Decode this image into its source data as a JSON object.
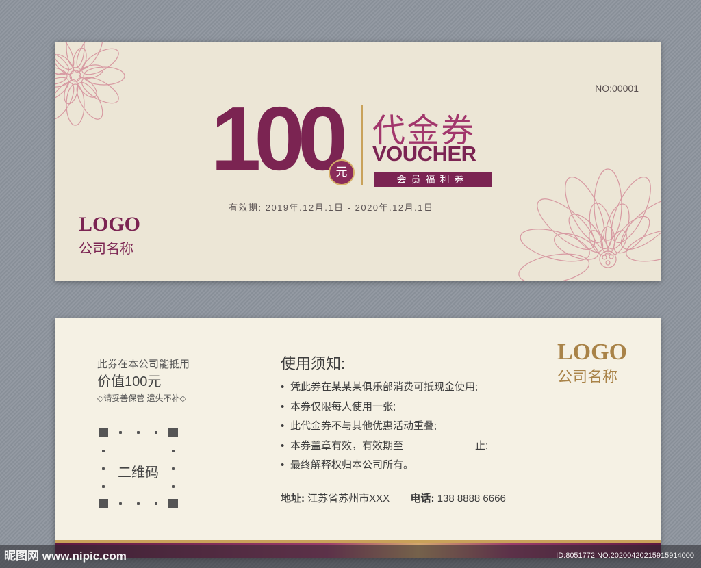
{
  "front": {
    "serial": "NO:00001",
    "amount": "100",
    "currency_badge": "元",
    "title_cn": "代金券",
    "title_en": "VOUCHER",
    "member_label": "会员福利券",
    "validity": "有效期: 2019年.12月.1日 - 2020年.12月.1日",
    "logo": "LOGO",
    "company": "公司名称"
  },
  "back": {
    "usage_line1": "此券在本公司能抵用",
    "usage_line2": "价值100元",
    "care_note": "◇请妥善保管 遗失不补◇",
    "qr_label": "二维码",
    "notice_title": "使用须知:",
    "rules": [
      "凭此券在某某某俱乐部消费可抵现金使用;",
      "本券仅限每人使用一张;",
      "此代金券不与其他优惠活动重叠;",
      "本券盖章有效，有效期至　　　　　　　止;",
      "最终解释权归本公司所有。"
    ],
    "address_label": "地址:",
    "address_value": "江苏省苏州市XXX",
    "phone_label": "电话:",
    "phone_value": "138 8888 6666",
    "logo": "LOGO",
    "company": "公司名称"
  },
  "watermark": {
    "site": "昵图网 www.nipic.com",
    "id_text": "ID:8051772 NO:20200420215915914000"
  },
  "colors": {
    "brand": "#7b2452",
    "gold": "#c9a25a",
    "front_bg": "#ece6d6",
    "back_bg": "#f5f1e4"
  }
}
